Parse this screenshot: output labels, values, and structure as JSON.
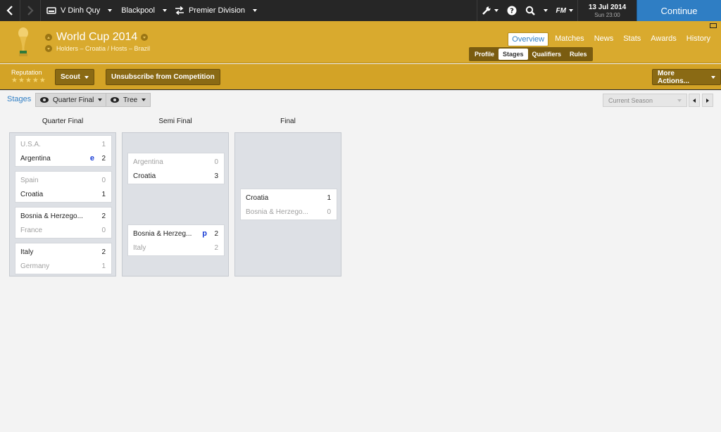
{
  "topbar": {
    "manager": "V Dinh Quy",
    "club": "Blackpool",
    "league": "Premier Division",
    "fm_logo": "FM",
    "date": "13 Jul 2014",
    "time": "Sun 23:00",
    "continue_label": "Continue"
  },
  "header": {
    "title": "World Cup 2014",
    "subtitle": "Holders – Croatia / Hosts – Brazil",
    "tabs": [
      "Overview",
      "Matches",
      "News",
      "Stats",
      "Awards",
      "History"
    ],
    "subtabs": [
      "Profile",
      "Stages",
      "Qualifiers",
      "Rules"
    ]
  },
  "actionbar": {
    "reputation_label": "Reputation",
    "stars": [
      "★",
      "★",
      "★",
      "★",
      "★"
    ],
    "scout_label": "Scout",
    "unsubscribe_label": "Unsubscribe from Competition",
    "more_actions_label": "More Actions..."
  },
  "content": {
    "breadcrumb": "Stages",
    "stage_filter": "Quarter Final",
    "view_filter": "Tree",
    "season_select": "Current Season"
  },
  "bracket": {
    "columns": [
      {
        "title": "Quarter Final",
        "matches": [
          {
            "team1": "U.S.A.",
            "score1": "1",
            "flag1": "",
            "team2": "Argentina",
            "score2": "2",
            "flag2": "e",
            "winner": 2
          },
          {
            "team1": "Spain",
            "score1": "0",
            "flag1": "",
            "team2": "Croatia",
            "score2": "1",
            "flag2": "",
            "winner": 2
          },
          {
            "team1": "Bosnia & Herzego...",
            "score1": "2",
            "flag1": "",
            "team2": "France",
            "score2": "0",
            "flag2": "",
            "winner": 1
          },
          {
            "team1": "Italy",
            "score1": "2",
            "flag1": "",
            "team2": "Germany",
            "score2": "1",
            "flag2": "",
            "winner": 1
          }
        ]
      },
      {
        "title": "Semi Final",
        "matches": [
          {
            "team1": "Argentina",
            "score1": "0",
            "flag1": "",
            "team2": "Croatia",
            "score2": "3",
            "flag2": "",
            "winner": 2
          },
          {
            "team1": "Bosnia & Herzeg...",
            "score1": "2",
            "flag1": "p",
            "team2": "Italy",
            "score2": "2",
            "flag2": "",
            "winner": 1
          }
        ]
      },
      {
        "title": "Final",
        "matches": [
          {
            "team1": "Croatia",
            "score1": "1",
            "flag1": "",
            "team2": "Bosnia & Herzego...",
            "score2": "0",
            "flag2": "",
            "winner": 1
          }
        ]
      }
    ]
  },
  "colors": {
    "accent": "#2f7ec4",
    "header_gold": "#d9aa2e",
    "topbar": "#262626"
  }
}
